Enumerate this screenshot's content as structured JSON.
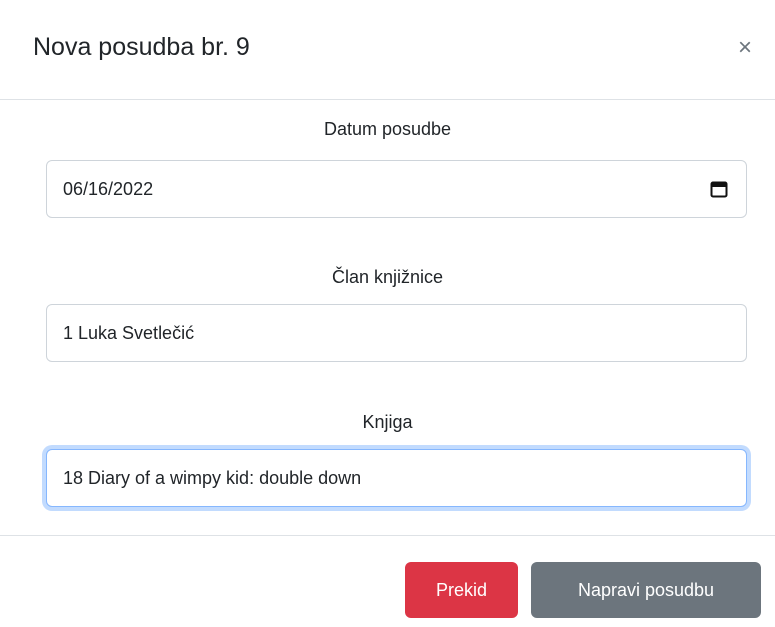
{
  "modal": {
    "title": "Nova posudba br. 9",
    "close_symbol": "×"
  },
  "fields": {
    "date": {
      "label": "Datum posudbe",
      "value": "06/16/2022",
      "icon": "calendar-icon"
    },
    "member": {
      "label": "Član knjižnice",
      "value": "1 Luka Svetlečić"
    },
    "book": {
      "label": "Knjiga",
      "value": "18 Diary of a wimpy kid: double down"
    }
  },
  "footer": {
    "cancel_label": "Prekid",
    "submit_label": "Napravi posudbu"
  },
  "colors": {
    "danger": "#dc3545",
    "secondary": "#6c757d",
    "focus": "#86b7fe"
  }
}
